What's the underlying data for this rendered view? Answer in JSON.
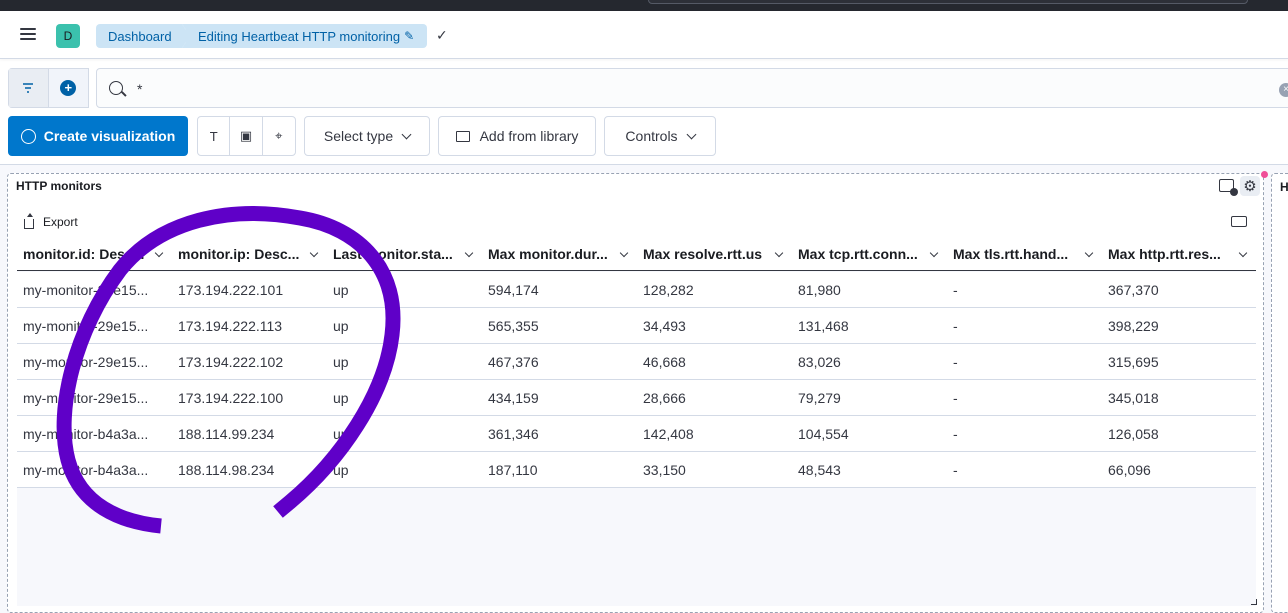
{
  "header": {
    "avatar_letter": "D",
    "breadcrumbs": [
      {
        "label": "Dashboard"
      },
      {
        "label": "Editing Heartbeat HTTP monitoring"
      }
    ],
    "pencil_icon": "✎",
    "check_icon": "✓"
  },
  "query_bar": {
    "query": "*",
    "clear_icon": "×"
  },
  "toolbar": {
    "create_label": "Create visualization",
    "select_type_label": "Select type",
    "add_library_label": "Add from library",
    "controls_label": "Controls",
    "icon_text": "T",
    "icon_image": "▣",
    "icon_map": "⌖"
  },
  "panel": {
    "title": "HTTP monitors",
    "export_label": "Export",
    "second_panel_title": "H",
    "gear_icon": "⚙"
  },
  "table": {
    "columns": [
      "monitor.id: Desc...",
      "monitor.ip: Desc...",
      "Last monitor.sta...",
      "Max monitor.dur...",
      "Max resolve.rtt.us",
      "Max tcp.rtt.conn...",
      "Max tls.rtt.hand...",
      "Max http.rtt.res..."
    ],
    "rows": [
      [
        "my-monitor-29e15...",
        "173.194.222.101",
        "up",
        "594,174",
        "128,282",
        "81,980",
        "-",
        "367,370"
      ],
      [
        "my-monitor-29e15...",
        "173.194.222.113",
        "up",
        "565,355",
        "34,493",
        "131,468",
        "-",
        "398,229"
      ],
      [
        "my-monitor-29e15...",
        "173.194.222.102",
        "up",
        "467,376",
        "46,668",
        "83,026",
        "-",
        "315,695"
      ],
      [
        "my-monitor-29e15...",
        "173.194.222.100",
        "up",
        "434,159",
        "28,666",
        "79,279",
        "-",
        "345,018"
      ],
      [
        "my-monitor-b4a3a...",
        "188.114.99.234",
        "up",
        "361,346",
        "142,408",
        "104,554",
        "-",
        "126,058"
      ],
      [
        "my-monitor-b4a3a...",
        "188.114.98.234",
        "up",
        "187,110",
        "33,150",
        "48,543",
        "-",
        "66,096"
      ]
    ]
  },
  "colors": {
    "accent": "#0077cc",
    "breadcrumb_bg": "#cce4f5",
    "avatar": "#3bc1ad",
    "scribble": "#5f00c8"
  }
}
